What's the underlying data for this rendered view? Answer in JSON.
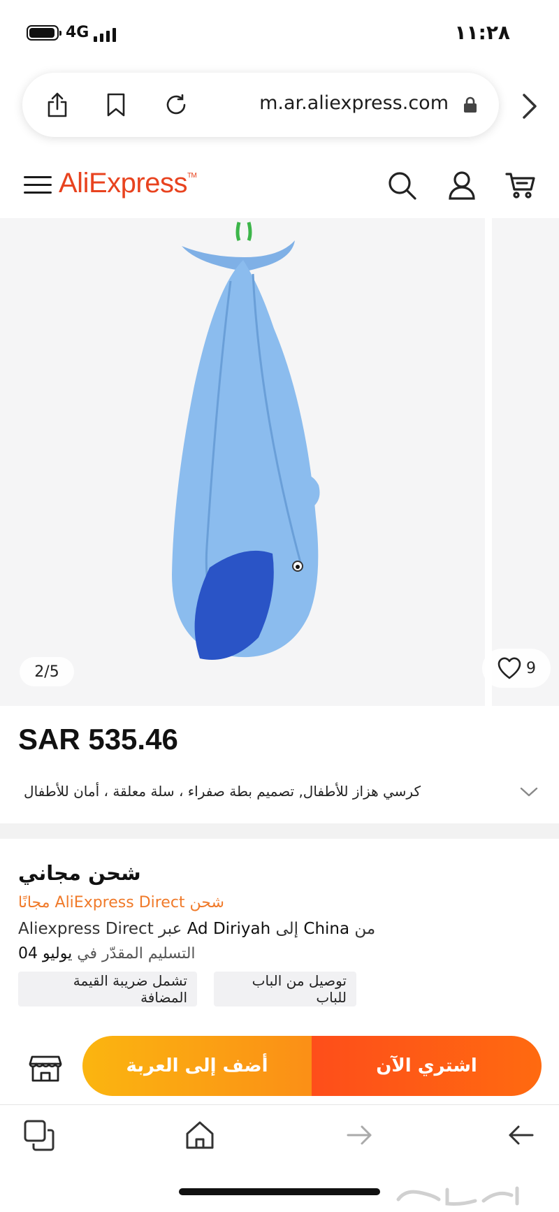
{
  "status_bar": {
    "time": "١١:٢٨",
    "network": "4G"
  },
  "browser": {
    "url": "m.ar.aliexpress.com"
  },
  "header": {
    "logo": "AliExpress"
  },
  "gallery": {
    "counter": "2/5",
    "likes": "9"
  },
  "product": {
    "price": "SAR 535.46",
    "title": "كرسي هزاز للأطفال, تصميم بطة صفراء ، سلة معلقة ، أمان للأطفال"
  },
  "shipping": {
    "title": "شحن مجاني",
    "direct": "شحن AliExpress Direct مجانًا",
    "route_via_label": "عبر",
    "route_carrier": "Aliexpress Direct",
    "route_to_label": "إلى",
    "route_destination": "Ad Diriyah",
    "route_from_label": "من",
    "route_origin": "China",
    "delivery_label": "التسليم المقدّر في",
    "delivery_date": "يوليو 04",
    "chips": [
      "توصيل من الباب للباب",
      "تشمل ضريبة القيمة المضافة"
    ]
  },
  "actions": {
    "add_to_cart": "أضف إلى العربة",
    "buy_now": "اشتري الآن"
  },
  "colors": {
    "brand": "#e8431f",
    "cart_button": "#fb9d14",
    "buy_button": "#fe5a15",
    "shipping_highlight": "#f07a2a"
  },
  "icons": [
    "share-icon",
    "bookmark-icon",
    "reload-icon",
    "lock-icon",
    "chevron-right-icon",
    "menu-icon",
    "search-icon",
    "account-icon",
    "cart-icon",
    "heart-icon",
    "chevron-down-icon",
    "store-icon",
    "tabs-icon",
    "home-icon",
    "forward-arrow-icon",
    "back-arrow-icon"
  ]
}
